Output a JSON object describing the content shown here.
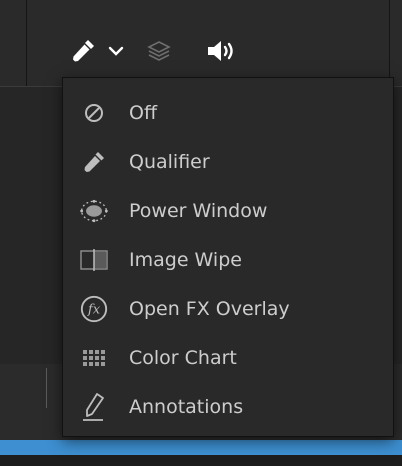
{
  "toolbar": {
    "tools": [
      {
        "name": "qualifier-picker",
        "icon": "eyedropper-icon"
      },
      {
        "name": "dropdown",
        "icon": "chevron-down-icon"
      },
      {
        "name": "layers",
        "icon": "layers-icon"
      },
      {
        "name": "audio",
        "icon": "speaker-icon"
      }
    ]
  },
  "menu": {
    "items": [
      {
        "label": "Off",
        "icon": "off-icon"
      },
      {
        "label": "Qualifier",
        "icon": "eyedropper-icon"
      },
      {
        "label": "Power Window",
        "icon": "power-window-icon"
      },
      {
        "label": "Image Wipe",
        "icon": "image-wipe-icon"
      },
      {
        "label": "Open FX Overlay",
        "icon": "fx-icon"
      },
      {
        "label": "Color Chart",
        "icon": "color-chart-icon"
      },
      {
        "label": "Annotations",
        "icon": "annotation-pen-icon"
      }
    ]
  },
  "colors": {
    "accent_blue": "#3d8fd1",
    "menu_bg": "#29292a",
    "text": "#cdcdcd"
  }
}
